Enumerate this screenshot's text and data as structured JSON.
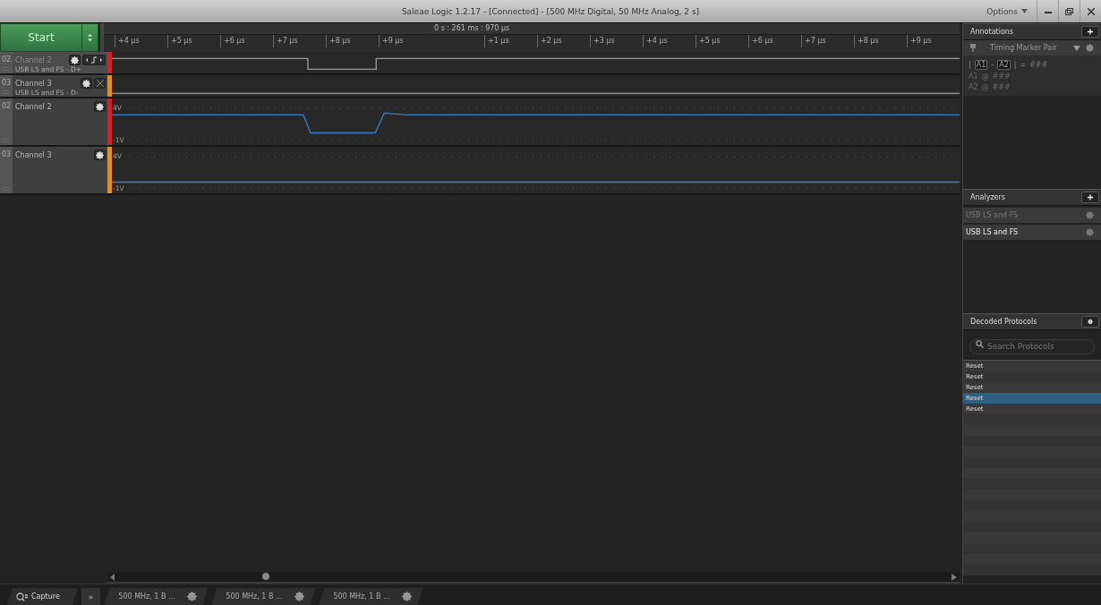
{
  "window": {
    "title": "Saleae Logic 1.2.17 - [Connected] - [500 MHz Digital, 50 MHz Analog, 2 s]",
    "menu": "Options"
  },
  "start_button": {
    "label": "Start"
  },
  "ruler": {
    "origin": "0 s : 261 ms : 970 µs",
    "ticks_before": [
      "+4 µs",
      "+5 µs",
      "+6 µs",
      "+7 µs",
      "+8 µs",
      "+9 µs"
    ],
    "ticks_after": [
      "+1 µs",
      "+2 µs",
      "+3 µs",
      "+4 µs",
      "+5 µs",
      "+6 µs",
      "+7 µs",
      "+8 µs",
      "+9 µs"
    ]
  },
  "channels": [
    {
      "kind": "digital",
      "index": "02",
      "name": "Channel 2",
      "subtitle": "USB LS and FS - D+",
      "color": "#c8262e",
      "selected": true
    },
    {
      "kind": "digital",
      "index": "03",
      "name": "Channel 3",
      "subtitle": "USB LS and FS - D-",
      "color": "#e0901c",
      "selected": false
    },
    {
      "kind": "analog",
      "index": "02",
      "name": "Channel 2",
      "scale_top": "4V",
      "scale_bottom": "-1V",
      "color": "#c8262e",
      "selected": false
    },
    {
      "kind": "analog",
      "index": "03",
      "name": "Channel 3",
      "scale_top": "4V",
      "scale_bottom": "-1V",
      "color": "#e0901c",
      "selected": false
    }
  ],
  "annotations": {
    "title": "Annotations",
    "marker": "Timing Marker Pair",
    "open_bar": "|",
    "a1": "A1",
    "minus": "-",
    "a2": "A2",
    "close_bar": "|",
    "equals": "=",
    "diff_value": "###",
    "rows": [
      {
        "label": "A1",
        "at": "@",
        "value": "###"
      },
      {
        "label": "A2",
        "at": "@",
        "value": "###"
      }
    ]
  },
  "analyzers": {
    "title": "Analyzers",
    "items": [
      {
        "name": "USB LS and FS",
        "disabled": true
      },
      {
        "name": "USB LS and FS",
        "disabled": false
      }
    ]
  },
  "decoded": {
    "title": "Decoded Protocols",
    "placeholder": "Search Protocols",
    "items": [
      {
        "text": "Reset",
        "selected": false
      },
      {
        "text": "Reset",
        "selected": false
      },
      {
        "text": "Reset",
        "selected": false
      },
      {
        "text": "Reset",
        "selected": true
      },
      {
        "text": "Reset",
        "selected": false
      }
    ]
  },
  "bottom_tabs": {
    "capture": "Capture",
    "more": "»",
    "sessions": [
      {
        "label": "500 MHz, 1 B ..."
      },
      {
        "label": "500 MHz, 1 B ..."
      },
      {
        "label": "500 MHz, 1 B ..."
      }
    ]
  }
}
